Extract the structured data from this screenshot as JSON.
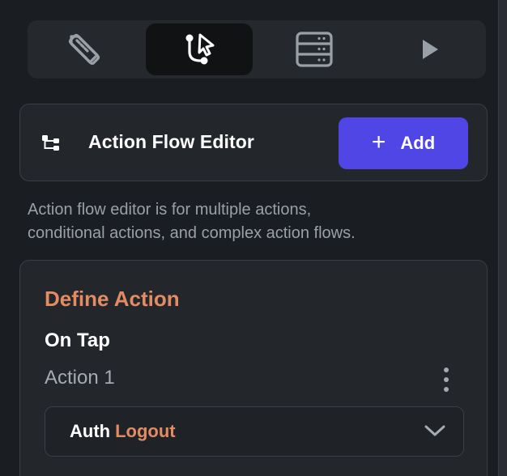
{
  "toolbar": {
    "tabs": [
      {
        "icon": "design-tools-icon",
        "active": false
      },
      {
        "icon": "action-flow-icon",
        "active": true
      },
      {
        "icon": "database-icon",
        "active": false
      },
      {
        "icon": "play-icon",
        "active": false
      }
    ]
  },
  "action_flow_editor": {
    "icon": "tree-nodes-icon",
    "title": "Action Flow Editor",
    "add_button": {
      "plus": "+",
      "label": "Add"
    },
    "description_line1": "Action flow editor is for multiple actions,",
    "description_line2": "conditional actions, and complex action flows."
  },
  "define_action": {
    "title": "Define Action",
    "trigger": "On Tap",
    "action_name": "Action 1",
    "action_select": {
      "category": "Auth",
      "value": "Logout"
    }
  },
  "colors": {
    "accent_button": "#4f46e5",
    "orange_text": "#e38b62",
    "panel_bg": "#23262b",
    "page_bg": "#1a1d21"
  }
}
